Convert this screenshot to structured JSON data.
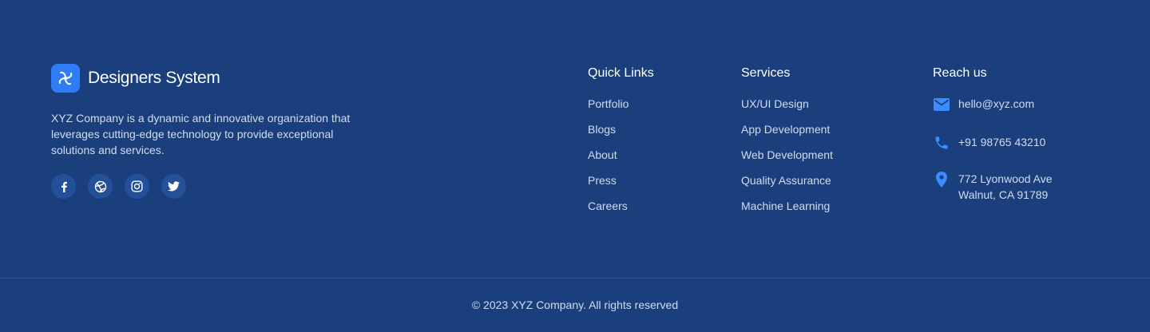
{
  "brand": {
    "name": "Designers System",
    "logo_icon": "pinwheel-logo-icon",
    "description": "XYZ Company is a dynamic and innovative organization that leverages cutting-edge technology to provide exceptional solutions and services."
  },
  "socials": [
    {
      "icon": "facebook-icon"
    },
    {
      "icon": "dribbble-icon"
    },
    {
      "icon": "instagram-icon"
    },
    {
      "icon": "twitter-icon"
    }
  ],
  "quick_links": {
    "title": "Quick Links",
    "items": [
      "Portfolio",
      "Blogs",
      "About",
      "Press",
      "Careers"
    ]
  },
  "services": {
    "title": "Services",
    "items": [
      "UX/UI Design",
      "App Development",
      "Web Development",
      "Quality Assurance",
      "Machine Learning"
    ]
  },
  "reach_us": {
    "title": "Reach us",
    "email": "hello@xyz.com",
    "phone": "+91 98765 43210",
    "address_line1": "772 Lyonwood Ave",
    "address_line2": "Walnut, CA 91789"
  },
  "footer": {
    "copyright": "© 2023 XYZ Company. All rights reserved"
  },
  "colors": {
    "background": "#1b3f7d",
    "accent": "#2f7df6",
    "icon_blue": "#3b8cff",
    "muted_text": "#cfdcf2"
  }
}
